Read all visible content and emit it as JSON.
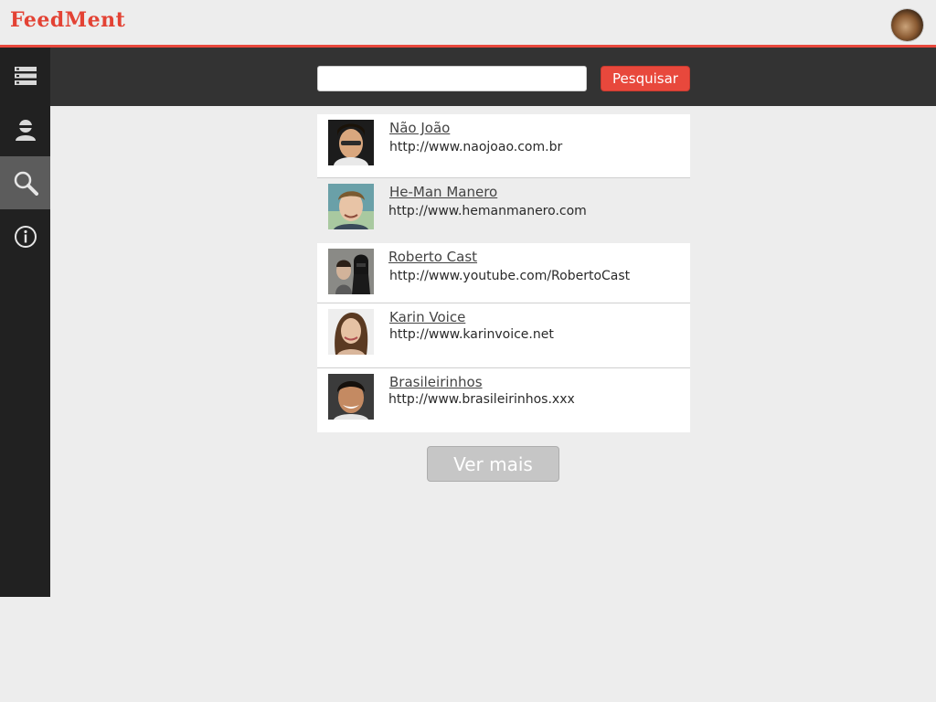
{
  "app": {
    "logo": "FeedMent"
  },
  "sidebar": {
    "items": [
      {
        "name": "feed",
        "icon": "list-icon"
      },
      {
        "name": "profile",
        "icon": "user-icon"
      },
      {
        "name": "search",
        "icon": "search-icon",
        "active": true
      },
      {
        "name": "info",
        "icon": "info-icon"
      }
    ]
  },
  "search": {
    "value": "",
    "placeholder": "",
    "button_label": "Pesquisar"
  },
  "results": [
    {
      "name": "Não João",
      "url": "http://www.naojoao.com.br"
    },
    {
      "name": "He-Man Manero",
      "url": "http://www.hemanmanero.com"
    },
    {
      "name": "Roberto Cast",
      "url": "http://www.youtube.com/RobertoCast"
    },
    {
      "name": "Karin Voice",
      "url": "http://www.karinvoice.net"
    },
    {
      "name": "Brasileirinhos",
      "url": "http://www.brasileirinhos.xxx"
    }
  ],
  "more": {
    "label": "Ver mais"
  },
  "colors": {
    "accent": "#e8483c",
    "sidebar": "#212121",
    "searchbar": "#333333",
    "background": "#ededed"
  }
}
